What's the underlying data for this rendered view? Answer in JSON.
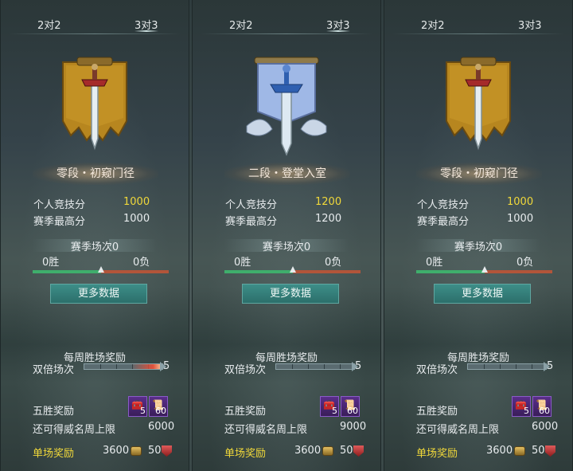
{
  "panels": [
    {
      "tabs": [
        "2对2",
        "3对3"
      ],
      "active_tab": 1,
      "emblem_icon": "golden-sword-banner-icon",
      "rank_name": "零段・初窥门径",
      "personal_score_label": "个人竞技分",
      "personal_score": "1000",
      "season_high_label": "赛季最高分",
      "season_high": "1000",
      "season_matches": "赛季场次0",
      "wins": "0胜",
      "losses": "0负",
      "win_ratio": 0.5,
      "more_data_button": "更多数据",
      "weekly_reward_title": "每周胜场奖励",
      "double_label": "双倍场次",
      "double_count": "5",
      "double_progress_glow": true,
      "five_win_label": "五胜奖励",
      "five_win_items": [
        {
          "icon": "treasure-chest-icon",
          "count": "5"
        },
        {
          "icon": "blue-scroll-icon",
          "count": "60"
        }
      ],
      "fame_cap_label": "还可得威名周上限",
      "fame_cap": "6000",
      "single_reward_label": "单场奖励",
      "single_gold": "3600",
      "single_fame": "50"
    },
    {
      "tabs": [
        "2对2",
        "3对3"
      ],
      "active_tab": 1,
      "emblem_icon": "silver-sword-banner-icon",
      "rank_name": "二段・登堂入室",
      "personal_score_label": "个人竞技分",
      "personal_score": "1200",
      "season_high_label": "赛季最高分",
      "season_high": "1200",
      "season_matches": "赛季场次0",
      "wins": "0胜",
      "losses": "0负",
      "win_ratio": 0.5,
      "more_data_button": "更多数据",
      "weekly_reward_title": "每周胜场奖励",
      "double_label": "双倍场次",
      "double_count": "5",
      "double_progress_glow": false,
      "five_win_label": "五胜奖励",
      "five_win_items": [
        {
          "icon": "treasure-chest-icon",
          "count": "5"
        },
        {
          "icon": "blue-scroll-icon",
          "count": "60"
        }
      ],
      "fame_cap_label": "还可得威名周上限",
      "fame_cap": "9000",
      "single_reward_label": "单场奖励",
      "single_gold": "3600",
      "single_fame": "50"
    },
    {
      "tabs": [
        "2对2",
        "3对3"
      ],
      "active_tab": -1,
      "emblem_icon": "golden-sword-banner-icon",
      "rank_name": "零段・初窥门径",
      "personal_score_label": "个人竞技分",
      "personal_score": "1000",
      "season_high_label": "赛季最高分",
      "season_high": "1000",
      "season_matches": "赛季场次0",
      "wins": "0胜",
      "losses": "0负",
      "win_ratio": 0.5,
      "more_data_button": "更多数据",
      "weekly_reward_title": "每周胜场奖励",
      "double_label": "双倍场次",
      "double_count": "5",
      "double_progress_glow": false,
      "five_win_label": "五胜奖励",
      "five_win_items": [
        {
          "icon": "treasure-chest-icon",
          "count": "5"
        },
        {
          "icon": "blue-scroll-icon",
          "count": "60"
        }
      ],
      "fame_cap_label": "还可得威名周上限",
      "fame_cap": "6000",
      "single_reward_label": "单场奖励",
      "single_gold": "3600",
      "single_fame": "50"
    }
  ],
  "colors": {
    "score_gold": "#f0d83a",
    "win_bar": "#3fae6c",
    "loss_bar": "#b2553a",
    "button_teal": "#3d8e88"
  }
}
